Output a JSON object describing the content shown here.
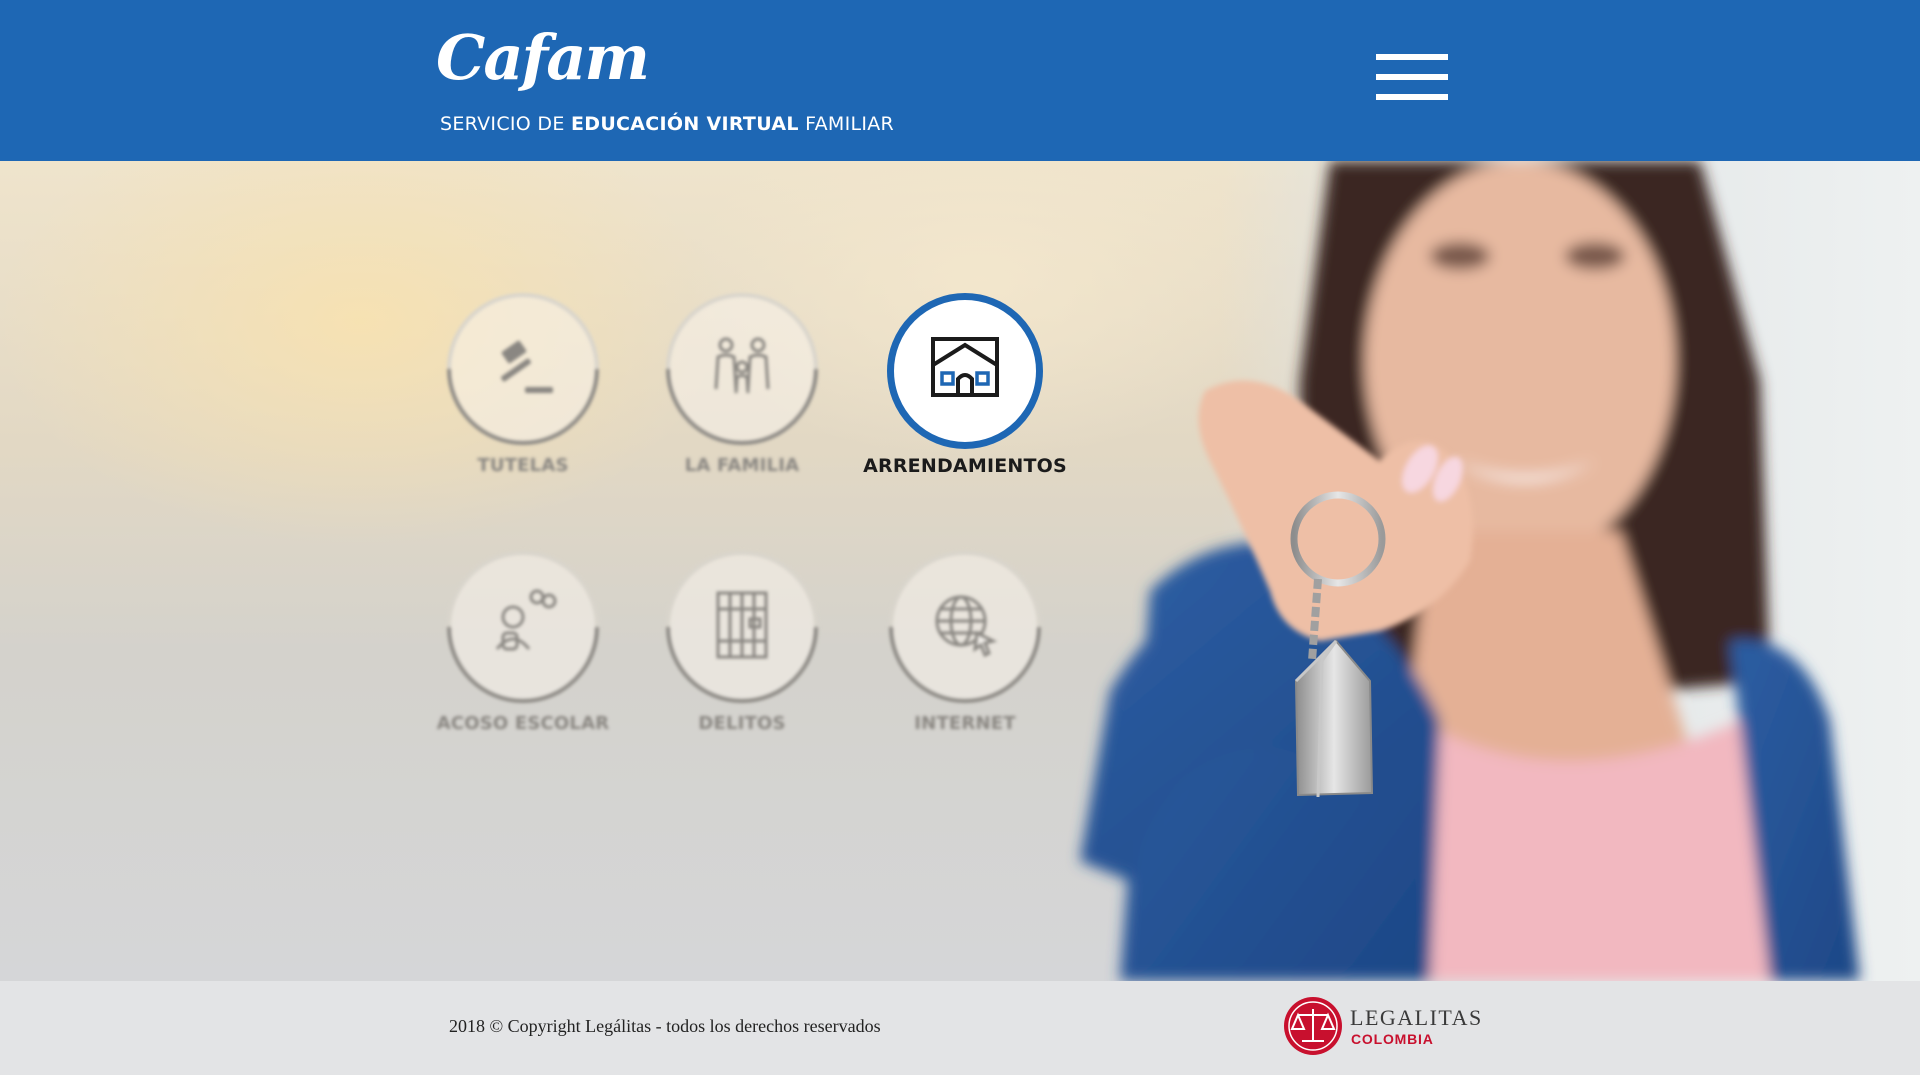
{
  "header": {
    "logo_text": "Cafam",
    "tagline_pre": "SERVICIO DE ",
    "tagline_bold": "EDUCACIÓN VIRTUAL",
    "tagline_post": " FAMILIAR",
    "menu_icon": "hamburger-menu-icon"
  },
  "colors": {
    "brand_blue": "#1e67b4",
    "legalitas_red": "#c8102e",
    "footer_bg": "#e3e4e6"
  },
  "categories": [
    {
      "label": "TUTELAS",
      "icon": "gavel-icon",
      "active": false
    },
    {
      "label": "LA FAMILIA",
      "icon": "family-icon",
      "active": false
    },
    {
      "label": "ARRENDAMIENTOS",
      "icon": "house-icon",
      "active": true
    },
    {
      "label": "ACOSO ESCOLAR",
      "icon": "bullying-icon",
      "active": false
    },
    {
      "label": "DELITOS",
      "icon": "jail-bars-icon",
      "active": false
    },
    {
      "label": "INTERNET",
      "icon": "globe-cursor-icon",
      "active": false
    }
  ],
  "footer": {
    "copyright": "2018 © Copyright Legálitas - todos los derechos reservados",
    "partner_name": "LEGALITAS",
    "partner_country": "COLOMBIA",
    "partner_icon": "scales-of-justice-icon"
  }
}
